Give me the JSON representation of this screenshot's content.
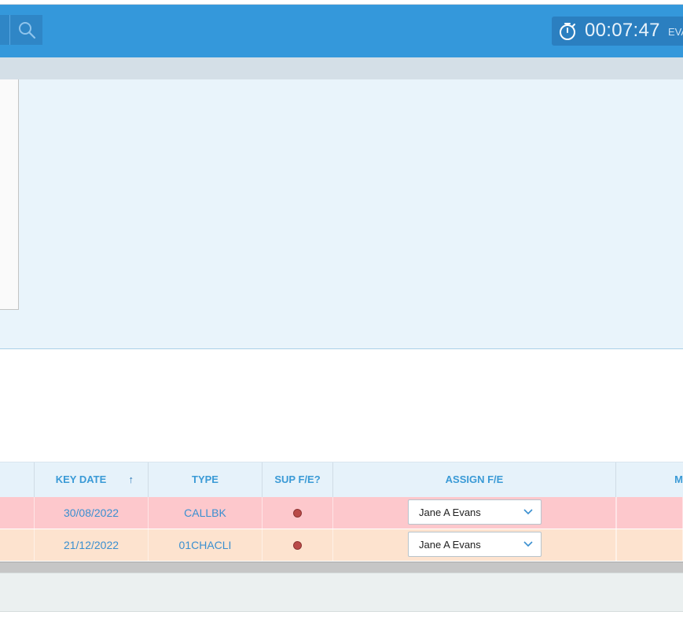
{
  "header": {
    "timer": "00:07:47",
    "user_partial": "EVA"
  },
  "table": {
    "columns": {
      "key_date": "KEY DATE",
      "type": "TYPE",
      "sup_fe": "SUP F/E?",
      "assign_fe": "ASSIGN F/E",
      "partial": "M"
    },
    "sort_icon": "arrow-up-icon",
    "rows": [
      {
        "key_date": "30/08/2022",
        "type": "CALLBK",
        "sup_fe_status": "red-dot",
        "assign_fe": "Jane A Evans",
        "row_color": "#fdc8cc"
      },
      {
        "key_date": "21/12/2022",
        "type": "01CHACLI",
        "sup_fe_status": "red-dot",
        "assign_fe": "Jane A Evans",
        "row_color": "#fde3cf"
      }
    ]
  },
  "colors": {
    "header": "#3498db",
    "accent_text": "#3a9ad6",
    "status_dot": "#b94a48"
  }
}
